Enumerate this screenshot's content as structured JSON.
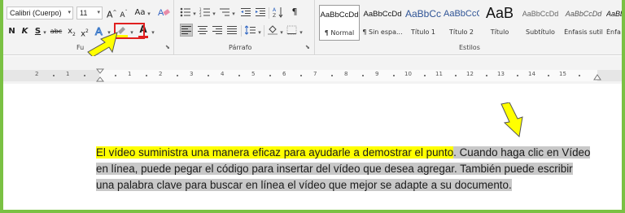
{
  "font_group": {
    "font_name": "Calibri (Cuerpo)",
    "font_size": "11",
    "grow_label": "A",
    "shrink_label": "A",
    "case_label": "Aa",
    "bold_label": "N",
    "italic_label": "K",
    "underline_label": "S",
    "strike_label": "abc",
    "subscript_label": "x",
    "superscript_label": "x",
    "font_color_label": "A",
    "highlight_color": "#ffff00",
    "font_color": "#e02020",
    "group_label": "Fu"
  },
  "paragraph_group": {
    "group_label": "Párrafo",
    "pilcrow": "¶"
  },
  "styles_group": {
    "group_label": "Estilos",
    "items": [
      {
        "sample": "AaBbCcDd",
        "name": "¶ Normal"
      },
      {
        "sample": "AaBbCcDd",
        "name": "¶ Sin espa..."
      },
      {
        "sample": "AaBbCc",
        "name": "Título 1"
      },
      {
        "sample": "AaBbCcC",
        "name": "Título 2"
      },
      {
        "sample": "AaB",
        "name": "Título"
      },
      {
        "sample": "AaBbCcDd",
        "name": "Subtítulo"
      },
      {
        "sample": "AaBbCcDd",
        "name": "Énfasis sutil"
      },
      {
        "sample": "AaBbCcDd",
        "name": "Énfa"
      }
    ]
  },
  "ruler": {
    "left_labels": [
      "2",
      "1"
    ],
    "labels": [
      "1",
      "2",
      "3",
      "4",
      "5",
      "6",
      "7",
      "8",
      "9",
      "10",
      "11",
      "12",
      "13",
      "14",
      "15"
    ]
  },
  "document": {
    "highlighted_text": "El vídeo suministra una manera eficaz para ayudarle a demostrar el punto",
    "period": ".",
    "selected_text_1": " Cuando haga clic en Vídeo",
    "selected_text_2": "en línea, puede pegar el código para insertar del vídeo que desea agregar. También puede escribir",
    "selected_text_3": "una palabra clave para buscar en línea el vídeo que mejor se adapte a su documento."
  },
  "colors": {
    "border_green": "#7ac143",
    "arrow_yellow": "#ffff00",
    "selection_gray": "#c8c8c8",
    "callout_red": "#e02020"
  }
}
